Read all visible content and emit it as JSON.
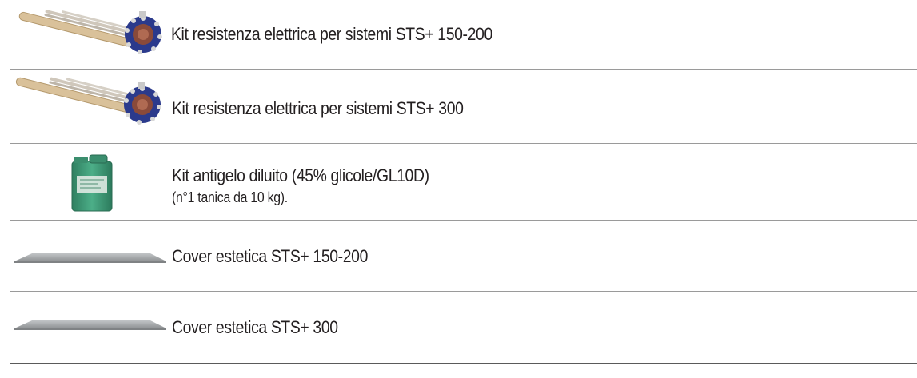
{
  "items": [
    {
      "label": "Kit resistenza elettrica per sistemi STS+ 150-200",
      "image_icon": "heating-element-flange"
    },
    {
      "label": "Kit resistenza elettrica per sistemi STS+ 300",
      "image_icon": "heating-element-flange"
    },
    {
      "label": "Kit antigelo diluito (45% glicole/GL10D)",
      "sublabel": "(n°1 tanica da 10 kg).",
      "image_icon": "antifreeze-canister"
    },
    {
      "label": "Cover estetica STS+ 150-200",
      "image_icon": "cover-panel"
    },
    {
      "label": "Cover estetica STS+ 300",
      "image_icon": "cover-panel"
    }
  ],
  "colors": {
    "text": "#231f20",
    "divider": "#9a9a9a",
    "flange": "#2b3a8c",
    "rod": "#d9c19a",
    "canister": "#3f9a78",
    "cover": "#a9acae"
  }
}
